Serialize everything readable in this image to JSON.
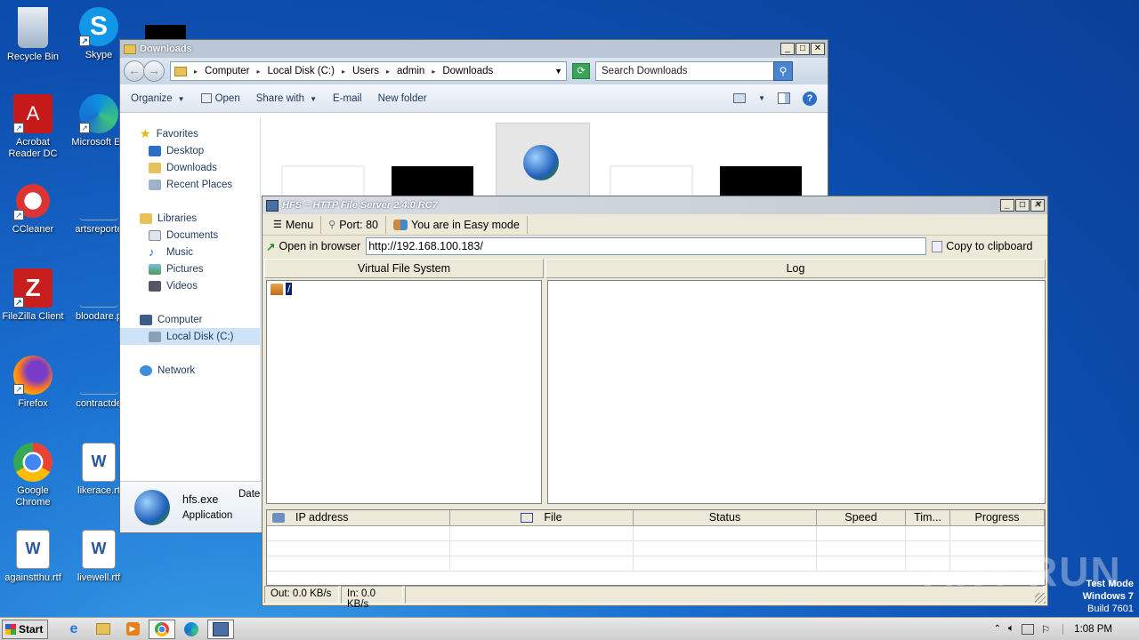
{
  "desktop_icons": [
    {
      "label": "Recycle Bin"
    },
    {
      "label": "Skype"
    },
    {
      "label": "Acrobat\nReader DC"
    },
    {
      "label": "Microsoft Ed"
    },
    {
      "label": "CCleaner"
    },
    {
      "label": "artsreporte"
    },
    {
      "label": "FileZilla Client"
    },
    {
      "label": "bloodare.p"
    },
    {
      "label": "Firefox"
    },
    {
      "label": "contractde"
    },
    {
      "label": "Google\nChrome"
    },
    {
      "label": "likerace.rt"
    },
    {
      "label": "againstthu.rtf"
    },
    {
      "label": "livewell.rtf"
    }
  ],
  "explorer": {
    "title": "Downloads",
    "breadcrumb": [
      "Computer",
      "Local Disk (C:)",
      "Users",
      "admin",
      "Downloads"
    ],
    "search_placeholder": "Search Downloads",
    "commands": {
      "organize": "Organize",
      "open": "Open",
      "share": "Share with",
      "email": "E-mail",
      "newfolder": "New folder"
    },
    "nav": {
      "favorites": "Favorites",
      "desktop": "Desktop",
      "downloads": "Downloads",
      "recent": "Recent Places",
      "libraries": "Libraries",
      "documents": "Documents",
      "music": "Music",
      "pictures": "Pictures",
      "videos": "Videos",
      "computer": "Computer",
      "localdisk": "Local Disk (C:)",
      "network": "Network"
    },
    "details": {
      "name": "hfs.exe",
      "type": "Application",
      "date_label": "Date"
    }
  },
  "hfs": {
    "title": "HFS ~ HTTP File Server 2.4.0 RC7",
    "menu": "Menu",
    "port": "Port: 80",
    "mode": "You are in Easy mode",
    "open_browser": "Open in browser",
    "url": "http://192.168.100.183/",
    "copy": "Copy to clipboard",
    "vfs_header": "Virtual File System",
    "vfs_root": "/",
    "log_header": "Log",
    "columns": [
      "IP address",
      "File",
      "Status",
      "Speed",
      "Tim...",
      "Progress"
    ],
    "status_out": "Out: 0.0 KB/s",
    "status_in": "In: 0.0 KB/s"
  },
  "taskbar": {
    "start": "Start",
    "time": "1:08 PM"
  },
  "system": {
    "test_mode": "Test Mode",
    "os": "Windows 7",
    "build": "Build 7601"
  },
  "watermark": "ANY RUN"
}
